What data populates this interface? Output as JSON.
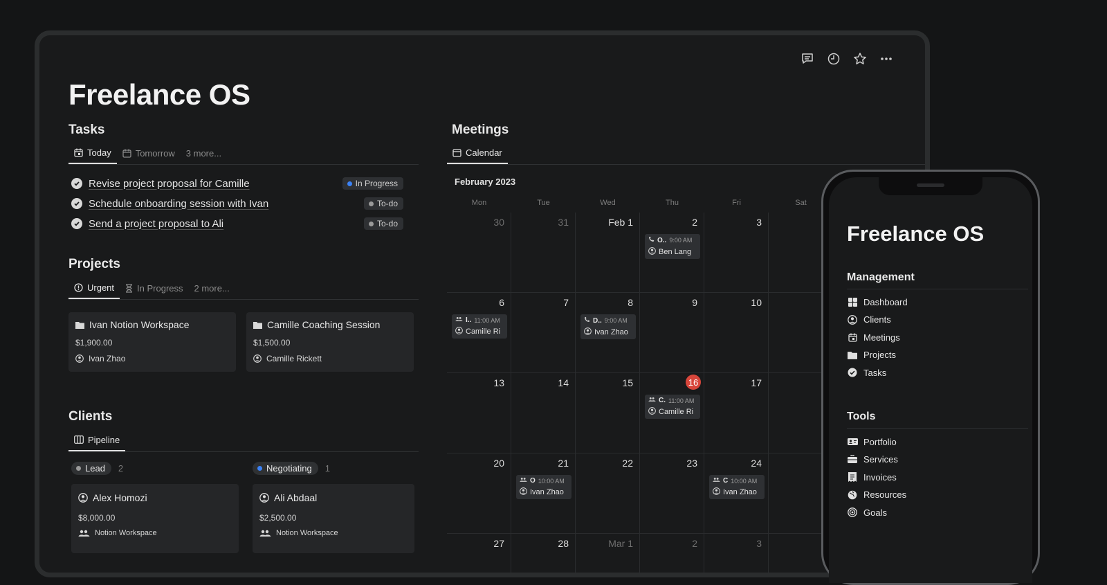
{
  "page": {
    "title": "Freelance OS"
  },
  "tasks": {
    "heading": "Tasks",
    "tabs": [
      "Today",
      "Tomorrow",
      "3 more..."
    ],
    "items": [
      {
        "text": "Revise project proposal for Camille",
        "status": "In Progress",
        "status_color": "#3b82f6"
      },
      {
        "text": "Schedule onboarding session with Ivan",
        "status": "To-do",
        "status_color": "#9a9a9a"
      },
      {
        "text": "Send a project proposal to Ali",
        "status": "To-do",
        "status_color": "#9a9a9a"
      }
    ]
  },
  "projects": {
    "heading": "Projects",
    "tabs": [
      "Urgent",
      "In Progress",
      "2 more..."
    ],
    "cards": [
      {
        "title": "Ivan Notion Workspace",
        "amount": "$1,900.00",
        "person": "Ivan Zhao"
      },
      {
        "title": "Camille Coaching Session",
        "amount": "$1,500.00",
        "person": "Camille Rickett"
      }
    ]
  },
  "clients": {
    "heading": "Clients",
    "tab": "Pipeline",
    "groups": [
      {
        "label": "Lead",
        "count": "2",
        "card": {
          "name": "Alex Homozi",
          "amount": "$8,000.00",
          "company": "Notion Workspace"
        }
      },
      {
        "label": "Negotiating",
        "count": "1",
        "card": {
          "name": "Ali Abdaal",
          "amount": "$2,500.00",
          "company": "Notion Workspace"
        }
      }
    ]
  },
  "meetings": {
    "heading": "Meetings",
    "tab": "Calendar",
    "month": "February 2023",
    "weekdays": [
      "Mon",
      "Tue",
      "Wed",
      "Thu",
      "Fri",
      "Sat"
    ],
    "weeks": [
      [
        "30",
        "31",
        "Feb 1",
        "2",
        "3",
        ""
      ],
      [
        "6",
        "7",
        "8",
        "9",
        "10",
        ""
      ],
      [
        "13",
        "14",
        "15",
        "16",
        "17",
        ""
      ],
      [
        "20",
        "21",
        "22",
        "23",
        "24",
        ""
      ],
      [
        "27",
        "28",
        "Mar 1",
        "2",
        "3",
        ""
      ]
    ],
    "today": "16",
    "events": [
      {
        "week": 0,
        "day": 3,
        "icon": "phone",
        "title": "O..",
        "time": "9:00 AM",
        "person": "Ben Lang"
      },
      {
        "week": 1,
        "day": 0,
        "icon": "people",
        "title": "I..",
        "time": "11:00 AM",
        "person": "Camille Ri"
      },
      {
        "week": 1,
        "day": 2,
        "icon": "phone",
        "title": "D..",
        "time": "9:00 AM",
        "person": "Ivan Zhao"
      },
      {
        "week": 2,
        "day": 3,
        "icon": "people",
        "title": "C.",
        "time": "11:00 AM",
        "person": "Camille Ri"
      },
      {
        "week": 3,
        "day": 1,
        "icon": "people",
        "title": "O",
        "time": "10:00 AM",
        "person": "Ivan Zhao"
      },
      {
        "week": 3,
        "day": 4,
        "icon": "people",
        "title": "C",
        "time": "10:00 AM",
        "person": "Ivan Zhao"
      }
    ]
  },
  "phone": {
    "title": "Freelance OS",
    "management": {
      "heading": "Management",
      "items": [
        {
          "label": "Dashboard",
          "icon": "dashboard-icon"
        },
        {
          "label": "Clients",
          "icon": "person-icon"
        },
        {
          "label": "Meetings",
          "icon": "calendar-icon"
        },
        {
          "label": "Projects",
          "icon": "folder-icon"
        },
        {
          "label": "Tasks",
          "icon": "check-circle-icon"
        }
      ]
    },
    "tools": {
      "heading": "Tools",
      "items": [
        {
          "label": "Portfolio",
          "icon": "id-card-icon"
        },
        {
          "label": "Services",
          "icon": "briefcase-icon"
        },
        {
          "label": "Invoices",
          "icon": "invoice-icon"
        },
        {
          "label": "Resources",
          "icon": "globe-icon"
        },
        {
          "label": "Goals",
          "icon": "target-icon"
        }
      ]
    }
  }
}
